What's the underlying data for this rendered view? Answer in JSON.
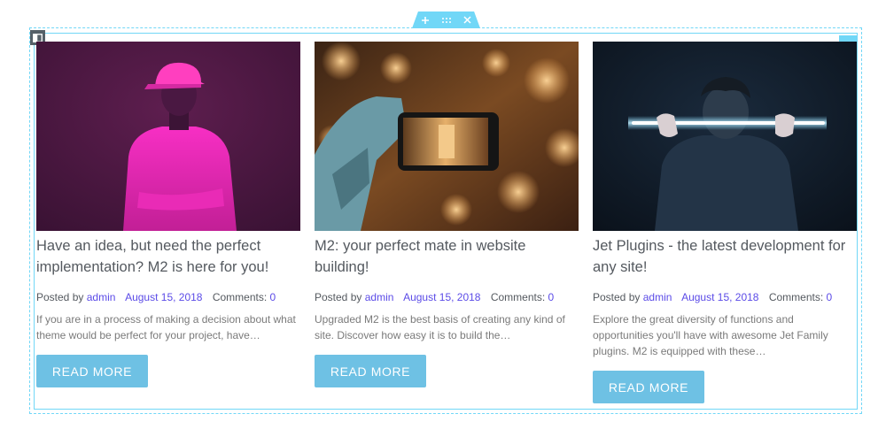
{
  "editor": {
    "section_handle_icons": [
      "plus-icon",
      "drag-handle-icon",
      "close-icon"
    ],
    "column_icon": "column-layout-icon",
    "edit_icon": "pencil-icon",
    "accent_color": "#71d7f7"
  },
  "posts": [
    {
      "title": "Have an idea, but need the perfect implementation? M2 is here for you!",
      "posted_by_label": "Posted by",
      "author": "admin",
      "date": "August 15, 2018",
      "comments_label": "Comments:",
      "comments_count": "0",
      "excerpt": "If you are in a process of making a decision about what theme would be perfect for your project, have…",
      "button_label": "READ MORE"
    },
    {
      "title": "M2: your perfect mate in website building!",
      "posted_by_label": "Posted by",
      "author": "admin",
      "date": "August 15, 2018",
      "comments_label": "Comments:",
      "comments_count": "0",
      "excerpt": "Upgraded M2 is the best basis of creating any kind of site. Discover how easy it is to build the…",
      "button_label": "READ MORE"
    },
    {
      "title": "Jet Plugins - the latest development for any site!",
      "posted_by_label": "Posted by",
      "author": "admin",
      "date": "August 15, 2018",
      "comments_label": "Comments:",
      "comments_count": "0",
      "excerpt": "Explore the great diversity of functions and opportunities you'll have with awesome Jet Family plugins. M2 is equipped with these…",
      "button_label": "READ MORE"
    }
  ],
  "colors": {
    "button": "#6ec1e4",
    "link": "#5b4be7",
    "title": "#54595f"
  }
}
